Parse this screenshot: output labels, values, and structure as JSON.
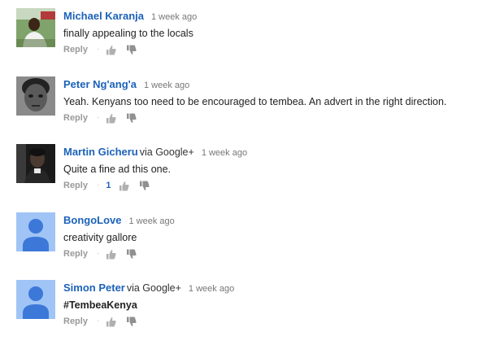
{
  "comments": [
    {
      "author": "Michael Karanja",
      "via": "",
      "time": "1 week ago",
      "text": "finally appealing to the locals",
      "reply_label": "Reply",
      "likes": "",
      "avatar": "photo-man-outdoor"
    },
    {
      "author": "Peter Ng'ang'a",
      "via": "",
      "time": "1 week ago",
      "text": "Yeah. Kenyans too need to be encouraged to tembea. An advert in the right direction.",
      "reply_label": "Reply",
      "likes": "",
      "avatar": "photo-face-bw"
    },
    {
      "author": "Martin Gicheru",
      "via": "via Google+",
      "time": "1 week ago",
      "text": "Quite a fine ad this one.",
      "reply_label": "Reply",
      "likes": "1",
      "avatar": "photo-man-dark"
    },
    {
      "author": "BongoLove",
      "via": "",
      "time": "1 week ago",
      "text": "creativity gallore",
      "reply_label": "Reply",
      "likes": "",
      "avatar": "default-user-icon"
    },
    {
      "author": "Simon Peter",
      "via": "via Google+",
      "time": "1 week ago",
      "text": "#TembeaKenya",
      "reply_label": "Reply",
      "likes": "",
      "avatar": "default-user-icon"
    }
  ],
  "colors": {
    "author": "#1c62b9",
    "meta": "#777777",
    "default_avatar_bg": "#a0c4f5",
    "default_avatar_fg": "#3c78d8"
  }
}
